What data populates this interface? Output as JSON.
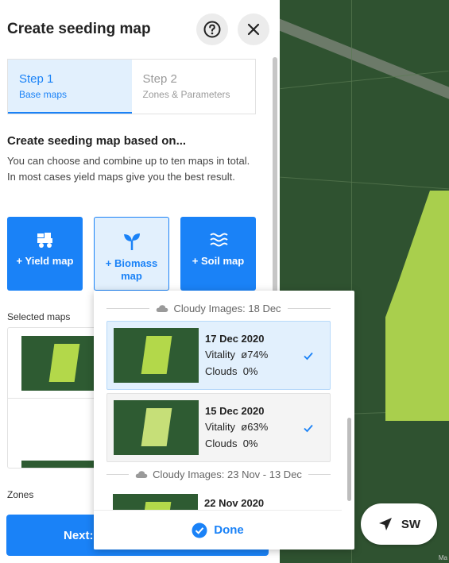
{
  "panel": {
    "title": "Create seeding map",
    "steps": [
      {
        "num": "Step 1",
        "label": "Base maps"
      },
      {
        "num": "Step 2",
        "label": "Zones & Parameters"
      }
    ],
    "section_title": "Create seeding map based on...",
    "section_desc": "You can choose and combine up to ten maps in total. In most cases yield maps give you the best result.",
    "map_types": [
      {
        "label": "+ Yield map",
        "icon": "harvester-icon"
      },
      {
        "label": "+ Biomass map",
        "icon": "sprout-icon"
      },
      {
        "label": "+ Soil map",
        "icon": "waves-icon"
      }
    ],
    "selected_maps_label": "Selected maps",
    "zones_label": "Zones",
    "next_label": "Next:"
  },
  "dropdown": {
    "groups": [
      {
        "header": "Cloudy Images: 18 Dec"
      },
      {
        "header": "Cloudy Images: 23 Nov - 13 Dec"
      }
    ],
    "images": [
      {
        "date": "17 Dec 2020",
        "vitality_label": "Vitality",
        "vitality": "ø74%",
        "clouds_label": "Clouds",
        "clouds": "0%",
        "selected": true
      },
      {
        "date": "15 Dec 2020",
        "vitality_label": "Vitality",
        "vitality": "ø63%",
        "clouds_label": "Clouds",
        "clouds": "0%",
        "selected": true
      },
      {
        "date": "22 Nov 2020"
      }
    ],
    "done_label": "Done"
  },
  "map": {
    "direction_label": "SW"
  },
  "colors": {
    "accent": "#1a82f7",
    "accent_light": "#e2f0fd"
  }
}
